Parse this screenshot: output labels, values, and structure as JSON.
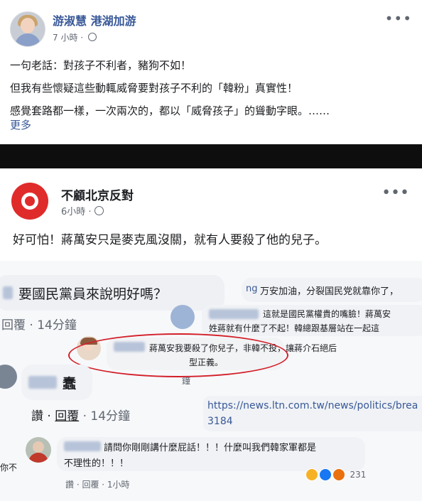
{
  "post": {
    "author": "游淑慧 港湖加游",
    "time": "7 小時 ·",
    "lines": [
      "一句老話：對孩子不利者，豬狗不如！",
      "但我有些懷疑這些動輒威脅要對孩子不利的「韓粉」真實性！",
      "感覺套路都一樣，一次兩次的，都以「威脅孩子」的聳動字眼。……"
    ],
    "see_more": "更多",
    "more_icon": "more-horizontal-icon",
    "privacy_icon": "globe-icon"
  },
  "screenshot": {
    "page_name": "不顧北京反對",
    "time": "6小時 ·",
    "text": "好可怕！蔣萬安只是麥克風沒關，就有人要殺了他的兒子。",
    "comments": {
      "c1_text": "要國民黨員來說明好嗎？",
      "c1_meta": "回覆 · 14分鐘",
      "c2_prefix": "ng",
      "c2_text": "万安加油，分裂国民党就靠你了，",
      "c3_line1": "這就是國民黨權貴的嘴臉！蔣萬安",
      "c3_line2": "姓蔣就有什麼了不起！韓總跟基層站在一起這",
      "c4_line1": "蔣萬安我要殺了你兒子，非韓不投，讓蔣介石絕后",
      "c4_line2": "型正義。",
      "c5_name": "蠢",
      "c5_meta_like": "讚",
      "c5_meta_reply": "回覆",
      "c5_meta_time": "· 14分鐘",
      "c5_side": "鐘",
      "link_line1": "https://news.ltn.com.tw/news/politics/brea",
      "link_line2": "3184",
      "c6_line1": "請問你剛剛講什麼屁話！！！什麼叫我們韓家軍都是",
      "c6_line2": "不理性的！！！",
      "c6_meta": "讚 · 回覆 · 1小時",
      "left_cut": "你不",
      "reaction_count": "231"
    },
    "colors": {
      "kmt_red": "#e02b2b",
      "annotation_red": "#d3202a",
      "link_blue": "#385898"
    }
  }
}
